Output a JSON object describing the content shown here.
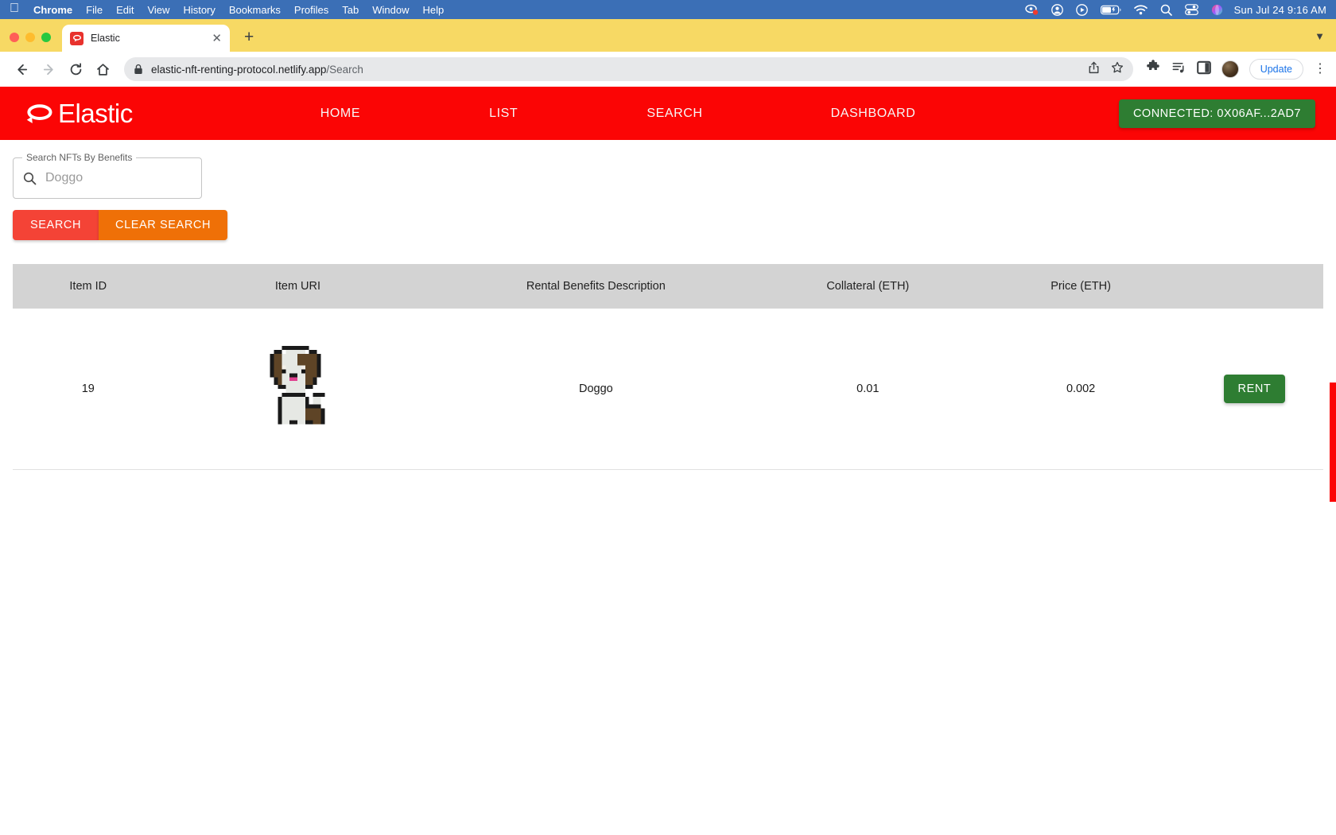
{
  "os_menubar": {
    "apple_icon": "apple-logo-icon",
    "items": [
      "Chrome",
      "File",
      "Edit",
      "View",
      "History",
      "Bookmarks",
      "Profiles",
      "Tab",
      "Window",
      "Help"
    ],
    "active_app": "Chrome",
    "status_icons": [
      "control-center-badge-icon",
      "user-account-icon",
      "play-circle-icon",
      "battery-icon",
      "wifi-icon",
      "spotlight-search-icon",
      "control-center-icon",
      "siri-icon"
    ],
    "clock": "Sun Jul 24  9:16 AM"
  },
  "browser": {
    "window_controls": [
      "close",
      "minimize",
      "maximize"
    ],
    "tab": {
      "title": "Elastic",
      "favicon": "elastic-loop-favicon",
      "close_icon": "close-icon"
    },
    "new_tab_label": "+",
    "tabstrip_chevron": "chevron-down-icon",
    "nav": {
      "back_icon": "back-arrow-icon",
      "forward_icon": "forward-arrow-icon",
      "reload_icon": "reload-icon",
      "home_icon": "home-icon"
    },
    "omnibox": {
      "lock_icon": "lock-icon",
      "url_domain": "elastic-nft-renting-protocol.netlify.app",
      "url_path": "/Search",
      "share_icon": "share-icon",
      "bookmark_icon": "star-icon"
    },
    "toolbar_right": {
      "extensions_icon": "puzzle-piece-icon",
      "reading_list_icon": "reading-list-icon",
      "side_panel_icon": "side-panel-icon",
      "avatar_icon": "profile-avatar",
      "update_label": "Update",
      "menu_icon": "kebab-menu-icon"
    }
  },
  "site": {
    "brand": {
      "logo_icon": "elastic-loop-icon",
      "name": "Elastic"
    },
    "nav_links": [
      "HOME",
      "LIST",
      "SEARCH",
      "DASHBOARD"
    ],
    "wallet_button": "CONNECTED: 0X06AF...2AD7",
    "colors": {
      "navbar": "#fb0505",
      "wallet_green": "#2e7d32",
      "search_red": "#f44336",
      "clear_orange": "#ef7007",
      "table_header": "#d3d3d3"
    }
  },
  "search": {
    "legend": "Search NFTs By Benefits",
    "icon": "search-icon",
    "value": "Doggo",
    "placeholder": "Doggo",
    "search_button": "SEARCH",
    "clear_button": "CLEAR SEARCH"
  },
  "table": {
    "columns": [
      "Item ID",
      "Item URI",
      "Rental Benefits Description",
      "Collateral (ETH)",
      "Price (ETH)",
      ""
    ],
    "rows": [
      {
        "item_id": "19",
        "item_uri_alt": "pixel-art-dog-nft",
        "description": "Doggo",
        "collateral": "0.01",
        "price": "0.002",
        "action": "RENT"
      }
    ]
  }
}
